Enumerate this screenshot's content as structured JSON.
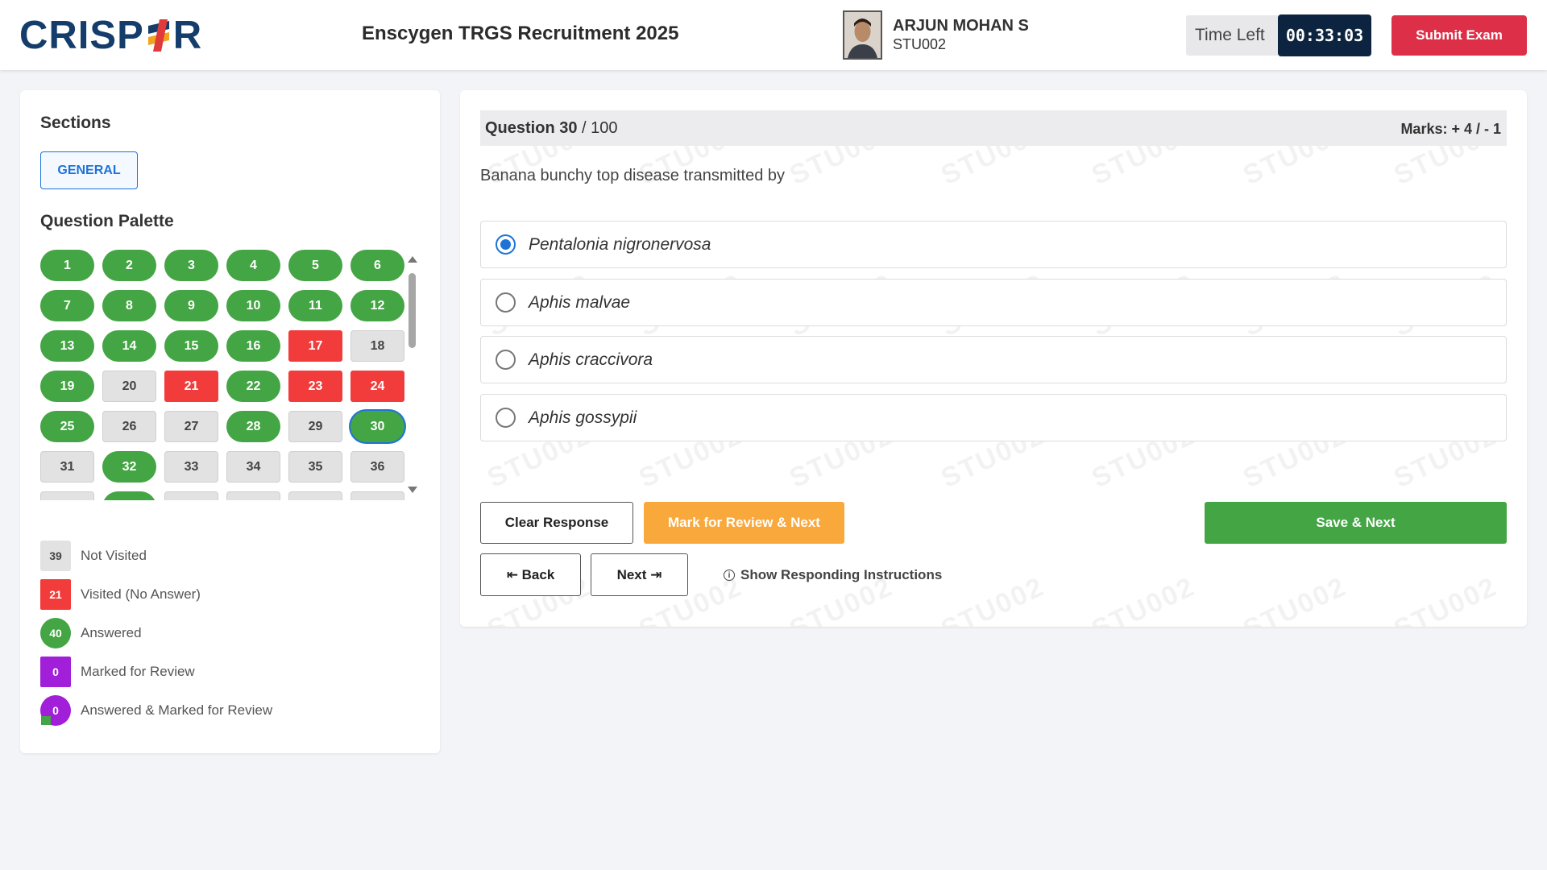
{
  "header": {
    "logo_text": "CRISPER",
    "exam_title": "Enscygen TRGS Recruitment 2025",
    "candidate_name": "ARJUN MOHAN S",
    "candidate_id": "STU002",
    "time_left_label": "Time Left",
    "timer": "00:33:03",
    "submit_label": "Submit Exam"
  },
  "sidebar": {
    "sections_title": "Sections",
    "section_button": "GENERAL",
    "palette_title": "Question Palette",
    "questions": [
      {
        "n": "1",
        "status": "answered"
      },
      {
        "n": "2",
        "status": "answered"
      },
      {
        "n": "3",
        "status": "answered"
      },
      {
        "n": "4",
        "status": "answered"
      },
      {
        "n": "5",
        "status": "answered"
      },
      {
        "n": "6",
        "status": "answered"
      },
      {
        "n": "7",
        "status": "answered"
      },
      {
        "n": "8",
        "status": "answered"
      },
      {
        "n": "9",
        "status": "answered"
      },
      {
        "n": "10",
        "status": "answered"
      },
      {
        "n": "11",
        "status": "answered"
      },
      {
        "n": "12",
        "status": "answered"
      },
      {
        "n": "13",
        "status": "answered"
      },
      {
        "n": "14",
        "status": "answered"
      },
      {
        "n": "15",
        "status": "answered"
      },
      {
        "n": "16",
        "status": "answered"
      },
      {
        "n": "17",
        "status": "visited-no-answer"
      },
      {
        "n": "18",
        "status": "not-visited"
      },
      {
        "n": "19",
        "status": "answered"
      },
      {
        "n": "20",
        "status": "not-visited"
      },
      {
        "n": "21",
        "status": "visited-no-answer"
      },
      {
        "n": "22",
        "status": "answered"
      },
      {
        "n": "23",
        "status": "visited-no-answer"
      },
      {
        "n": "24",
        "status": "visited-no-answer"
      },
      {
        "n": "25",
        "status": "answered"
      },
      {
        "n": "26",
        "status": "not-visited"
      },
      {
        "n": "27",
        "status": "not-visited"
      },
      {
        "n": "28",
        "status": "answered"
      },
      {
        "n": "29",
        "status": "not-visited"
      },
      {
        "n": "30",
        "status": "answered",
        "current": true
      },
      {
        "n": "31",
        "status": "not-visited"
      },
      {
        "n": "32",
        "status": "answered"
      },
      {
        "n": "33",
        "status": "not-visited"
      },
      {
        "n": "34",
        "status": "not-visited"
      },
      {
        "n": "35",
        "status": "not-visited"
      },
      {
        "n": "36",
        "status": "not-visited"
      },
      {
        "n": "",
        "status": "not-visited"
      },
      {
        "n": "",
        "status": "answered"
      },
      {
        "n": "",
        "status": "not-visited"
      },
      {
        "n": "",
        "status": "not-visited"
      },
      {
        "n": "",
        "status": "not-visited"
      },
      {
        "n": "",
        "status": "not-visited"
      }
    ],
    "legend": [
      {
        "count": "39",
        "label": "Not Visited",
        "kind": "not-visited"
      },
      {
        "count": "21",
        "label": "Visited (No Answer)",
        "kind": "visited-no-answer"
      },
      {
        "count": "40",
        "label": "Answered",
        "kind": "answered"
      },
      {
        "count": "0",
        "label": "Marked for Review",
        "kind": "marked"
      },
      {
        "count": "0",
        "label": "Answered & Marked for Review",
        "kind": "ans-marked"
      }
    ]
  },
  "question": {
    "label": "Question 30",
    "total": "/ 100",
    "marks": "Marks: + 4 / - 1",
    "text": "Banana bunchy top disease transmitted by",
    "options": [
      {
        "label": "Pentalonia nigronervosa",
        "selected": true
      },
      {
        "label": "Aphis malvae",
        "selected": false
      },
      {
        "label": "Aphis craccivora",
        "selected": false
      },
      {
        "label": "Aphis gossypii",
        "selected": false
      }
    ],
    "watermark": "STU002"
  },
  "actions": {
    "clear": "Clear Response",
    "mark_review": "Mark for Review & Next",
    "save_next": "Save & Next",
    "back": "⇤ Back",
    "next": "Next ⇥",
    "instructions": "Show Responding Instructions"
  },
  "colors": {
    "answered": "#43a543",
    "visited_no_answer": "#f23b3b",
    "not_visited": "#e2e2e2",
    "marked": "#a11fd8",
    "accent": "#1e73d8",
    "submit": "#dd2f47",
    "mark_review": "#f9a93c",
    "timer_bg": "#0d2440"
  }
}
